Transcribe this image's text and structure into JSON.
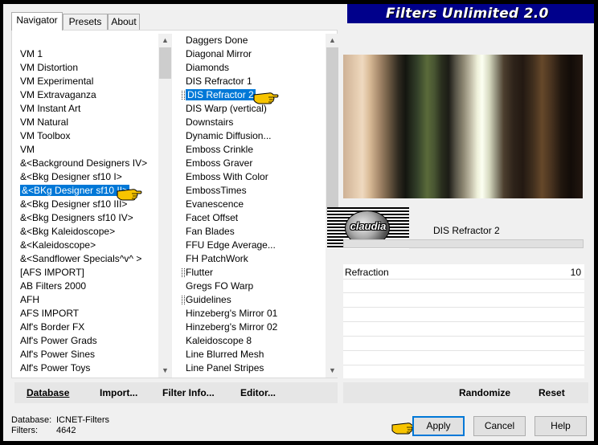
{
  "window": {
    "title": "Filters Unlimited 2.0"
  },
  "tabs": [
    {
      "label": "Navigator",
      "active": true
    },
    {
      "label": "Presets",
      "active": false
    },
    {
      "label": "About",
      "active": false
    }
  ],
  "categories": [
    {
      "label": "VM 1"
    },
    {
      "label": "VM Distortion"
    },
    {
      "label": "VM Experimental"
    },
    {
      "label": "VM Extravaganza"
    },
    {
      "label": "VM Instant Art"
    },
    {
      "label": "VM Natural"
    },
    {
      "label": "VM Toolbox"
    },
    {
      "label": "VM"
    },
    {
      "label": "&<Background Designers IV>"
    },
    {
      "label": "&<Bkg Designer sf10 I>"
    },
    {
      "label": "&<BKg Designer sf10 II>"
    },
    {
      "label": "&<Bkg Designer sf10 III>"
    },
    {
      "label": "&<Bkg Designers sf10 IV>"
    },
    {
      "label": "&<Bkg Kaleidoscope>"
    },
    {
      "label": "&<Kaleidoscope>"
    },
    {
      "label": "&<Sandflower Specials^v^ >"
    },
    {
      "label": "[AFS IMPORT]"
    },
    {
      "label": "AB Filters 2000"
    },
    {
      "label": "AFH"
    },
    {
      "label": "AFS IMPORT"
    },
    {
      "label": "Alf's Border FX"
    },
    {
      "label": "Alf's Power Grads"
    },
    {
      "label": "Alf's Power Sines"
    },
    {
      "label": "Alf's Power Toys"
    }
  ],
  "filters": [
    {
      "label": "Daggers Done"
    },
    {
      "label": "Diagonal Mirror"
    },
    {
      "label": "Diamonds"
    },
    {
      "label": "DIS Refractor 1"
    },
    {
      "label": "DIS Refractor 2"
    },
    {
      "label": "DIS Warp (vertical)"
    },
    {
      "label": "Downstairs"
    },
    {
      "label": "Dynamic Diffusion..."
    },
    {
      "label": "Emboss Crinkle"
    },
    {
      "label": "Emboss Graver"
    },
    {
      "label": "Emboss With Color"
    },
    {
      "label": "EmbossTimes"
    },
    {
      "label": "Evanescence"
    },
    {
      "label": "Facet Offset"
    },
    {
      "label": "Fan Blades"
    },
    {
      "label": "FFU Edge Average..."
    },
    {
      "label": "FH PatchWork"
    },
    {
      "label": "Flutter"
    },
    {
      "label": "Gregs FO Warp"
    },
    {
      "label": "Guidelines"
    },
    {
      "label": "Hinzeberg's Mirror 01"
    },
    {
      "label": "Hinzeberg's Mirror 02"
    },
    {
      "label": "Kaleidoscope 8"
    },
    {
      "label": "Line Blurred Mesh"
    },
    {
      "label": "Line Panel Stripes"
    }
  ],
  "selected_category_index": 10,
  "selected_filter_index": 4,
  "buttons": {
    "database": "Database",
    "import": "Import...",
    "filter_info": "Filter Info...",
    "editor": "Editor...",
    "randomize": "Randomize",
    "reset": "Reset",
    "apply": "Apply",
    "cancel": "Cancel",
    "help": "Help"
  },
  "current_filter": {
    "name": "DIS Refractor 2"
  },
  "logo_text": "claudia",
  "parameters": [
    {
      "label": "Refraction",
      "value": "10"
    }
  ],
  "status": {
    "database_label": "Database:",
    "database_value": "ICNET-Filters",
    "filters_label": "Filters:",
    "filters_value": "4642"
  },
  "colors": {
    "selection": "#0078d7",
    "title_bar": "#00008b"
  }
}
